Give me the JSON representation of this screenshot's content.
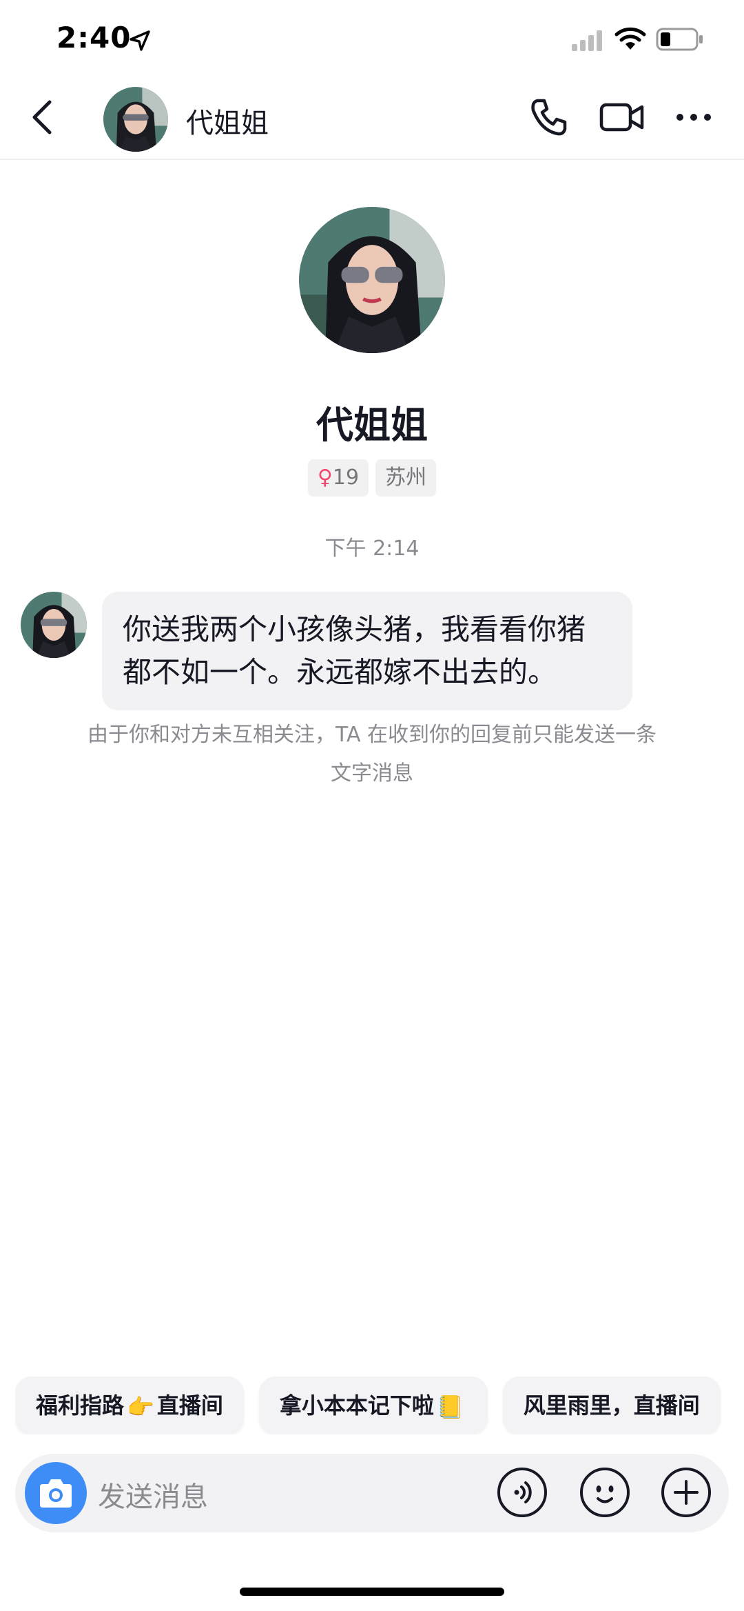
{
  "status_bar": {
    "time": "2:40",
    "icons": [
      "location-arrow-icon",
      "signal-icon",
      "wifi-icon",
      "battery-icon"
    ]
  },
  "header": {
    "name": "代姐姐",
    "icons": [
      "back-icon",
      "avatar",
      "phone-icon",
      "video-icon",
      "more-icon"
    ]
  },
  "profile": {
    "name": "代姐姐",
    "age": "19",
    "location": "苏州",
    "gender_color": "#f0466f"
  },
  "chat": {
    "timestamp": "下午 2:14",
    "message": "你送我两个小孩像头猪，我看看你猪都不如一个。永远都嫁不出去的。",
    "notice": "由于你和对方未互相关注，TA 在收到你的回复前只能发送一条文字消息"
  },
  "quick_replies": [
    {
      "before": "福利指路",
      "emoji": "👉",
      "after": "直播间"
    },
    {
      "before": "拿小本本记下啦",
      "emoji": "📒",
      "after": ""
    },
    {
      "before": "风里雨里，直播间",
      "emoji": "",
      "after": ""
    }
  ],
  "input_bar": {
    "placeholder": "发送消息",
    "camera_color": "#3e8df7",
    "icons": [
      "camera-icon",
      "voice-icon",
      "emoji-icon",
      "plus-icon"
    ]
  }
}
